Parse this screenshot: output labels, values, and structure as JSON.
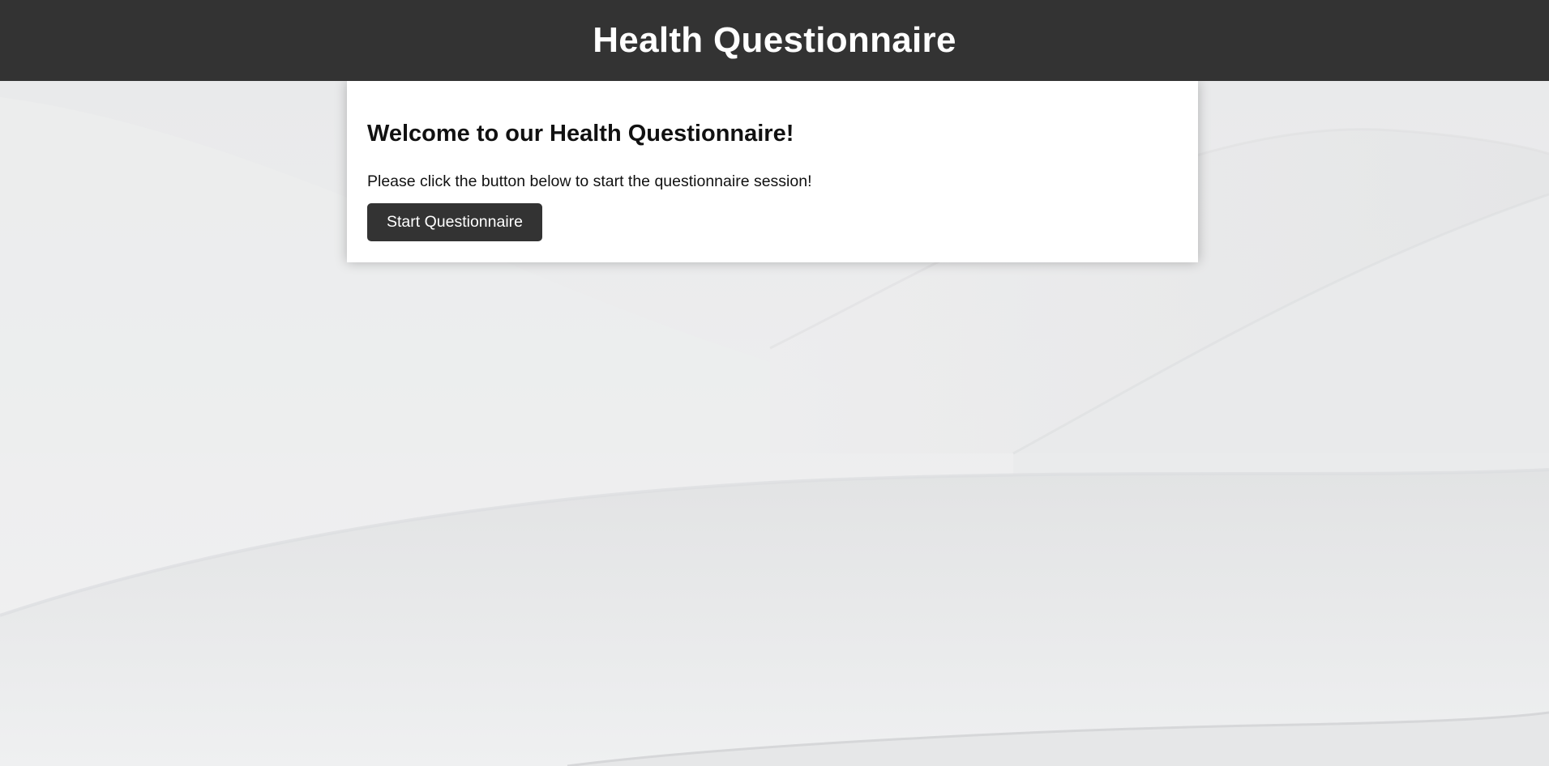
{
  "header": {
    "title": "Health Questionnaire"
  },
  "welcome": {
    "heading": "Welcome to our Health Questionnaire!",
    "instructions": "Please click the button below to start the questionnaire session!",
    "start_button_label": "Start Questionnaire"
  },
  "colors": {
    "header_bg": "#333333",
    "button_bg": "#333333",
    "page_bg": "#eeeff0",
    "card_bg": "#ffffff"
  }
}
